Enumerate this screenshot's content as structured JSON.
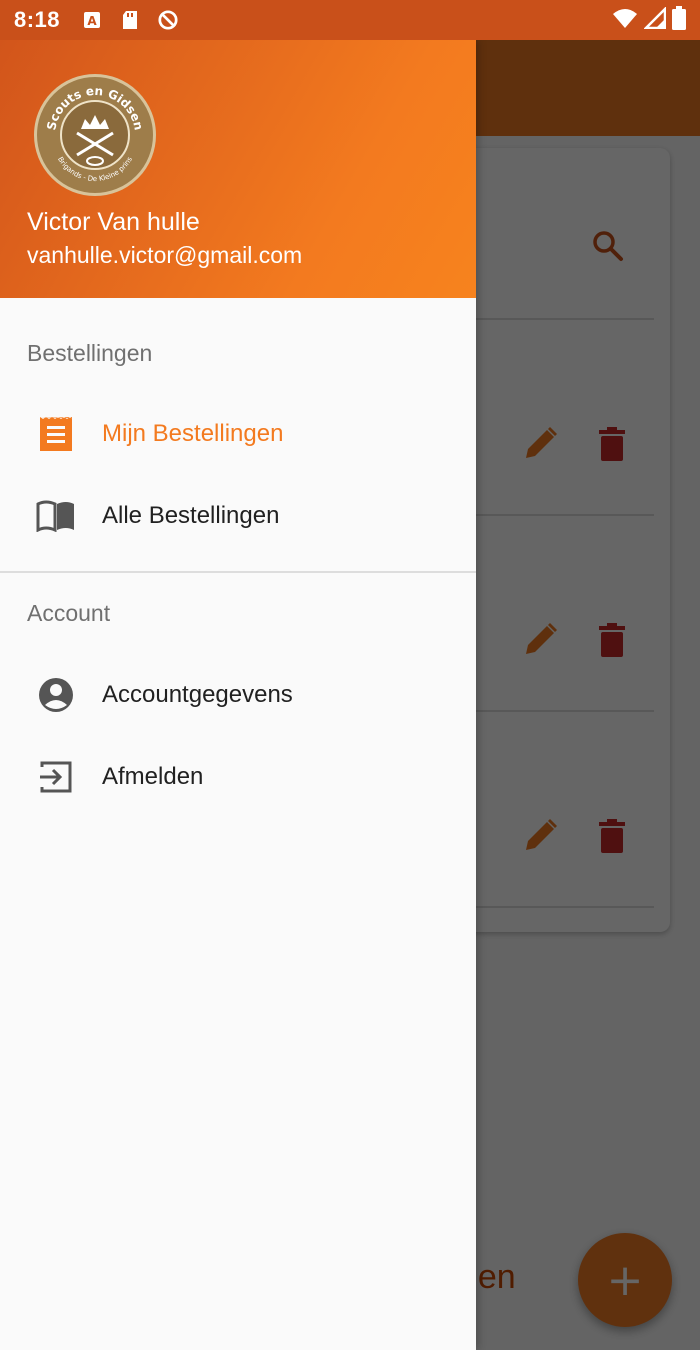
{
  "status_bar": {
    "time": "8:18",
    "left_icons": [
      "a-icon",
      "sd-card-icon",
      "no-sync-icon"
    ],
    "right_icons": [
      "wifi-icon",
      "signal-icon",
      "battery-icon"
    ]
  },
  "background_app": {
    "search_icon": "search-icon",
    "rows": [
      {
        "edit_icon": "pencil-icon",
        "delete_icon": "trash-icon"
      },
      {
        "edit_icon": "pencil-icon",
        "delete_icon": "trash-icon"
      },
      {
        "edit_icon": "pencil-icon",
        "delete_icon": "trash-icon"
      }
    ],
    "bottom_text": "egen",
    "fab_label": "+"
  },
  "drawer": {
    "header": {
      "logo_text_top": "Scouts en Gidsen",
      "logo_text_bottom": "Brigands - De Kleine prins",
      "user_name": "Victor Van hulle",
      "user_email": "vanhulle.victor@gmail.com"
    },
    "sections": [
      {
        "label": "Bestellingen",
        "items": [
          {
            "label": "Mijn Bestellingen",
            "icon": "receipt-icon",
            "active": true
          },
          {
            "label": "Alle Bestellingen",
            "icon": "book-icon",
            "active": false
          }
        ]
      },
      {
        "label": "Account",
        "items": [
          {
            "label": "Accountgegevens",
            "icon": "account-circle-icon",
            "active": false
          },
          {
            "label": "Afmelden",
            "icon": "logout-icon",
            "active": false
          }
        ]
      }
    ]
  },
  "colors": {
    "primary": "#f37a1f",
    "primary_dark": "#c9501a",
    "delete": "#c62828",
    "active_text": "#f37a1f"
  }
}
